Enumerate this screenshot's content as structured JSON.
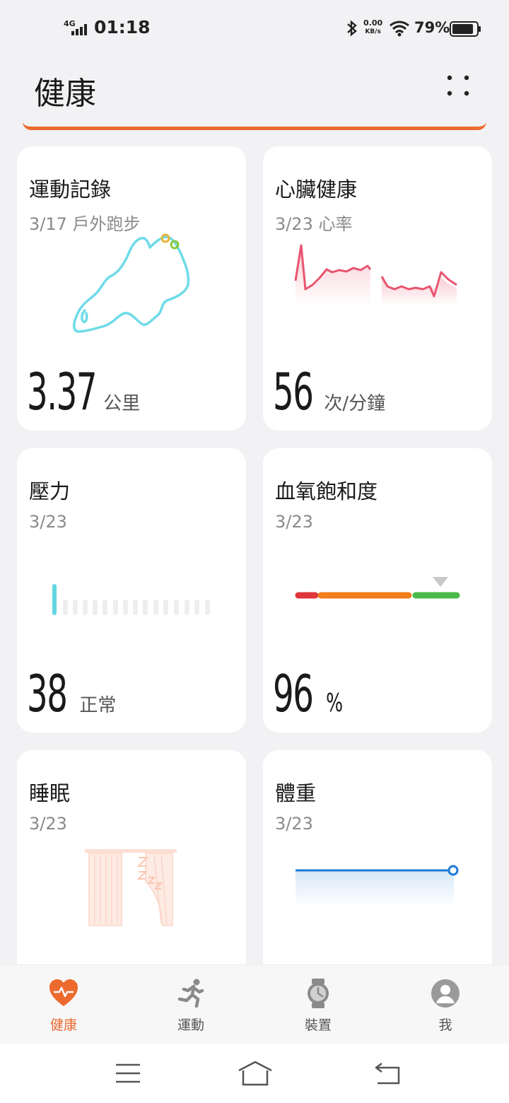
{
  "status_bar": {
    "network": "4G",
    "time": "01:18",
    "speed_value": "0.00",
    "speed_unit": "KB/s",
    "battery": "79%"
  },
  "header": {
    "title": "健康",
    "menu_icon": "grid-dots-icon",
    "accent": "#ec6a2e"
  },
  "cards": {
    "exercise": {
      "title": "運動記錄",
      "subtitle": "3/17 戶外跑步",
      "value": "3.37",
      "unit": "公里",
      "route_color": "#6fdbe8"
    },
    "heart": {
      "title": "心臟健康",
      "subtitle": "3/23 心率",
      "value": "56",
      "unit": "次/分鐘",
      "line_color": "#e8546e"
    },
    "stress": {
      "title": "壓力",
      "subtitle": "3/23",
      "value": "38",
      "unit": "正常",
      "bar_color": "#62d5e0"
    },
    "spo2": {
      "title": "血氧飽和度",
      "subtitle": "3/23",
      "value": "96",
      "unit": "%",
      "scale_colors": [
        "#e0353b",
        "#f27d1a",
        "#4bb84a"
      ]
    },
    "sleep": {
      "title": "睡眠",
      "subtitle": "3/23"
    },
    "weight": {
      "title": "體重",
      "subtitle": "3/23",
      "line_color": "#1e7ad6"
    }
  },
  "bottom_nav": [
    {
      "label": "健康",
      "icon": "heart-icon",
      "active": true
    },
    {
      "label": "運動",
      "icon": "running-icon",
      "active": false
    },
    {
      "label": "裝置",
      "icon": "watch-icon",
      "active": false
    },
    {
      "label": "我",
      "icon": "avatar-icon",
      "active": false
    }
  ],
  "system_nav": [
    "menu-icon",
    "home-icon",
    "back-icon"
  ]
}
